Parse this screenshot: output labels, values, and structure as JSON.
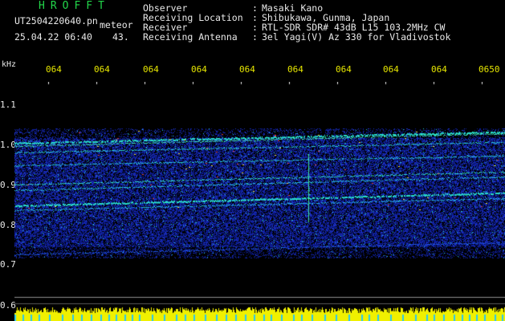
{
  "header": {
    "title": "HROFFT",
    "filename": "UT2504220640.pn",
    "meteor_label": "meteor",
    "datetime": "25.04.22 06:40",
    "count": "43."
  },
  "station": [
    {
      "label": "Observer",
      "value": "Masaki Kano"
    },
    {
      "label": "Receiving Location",
      "value": "Shibukawa, Gunma, Japan"
    },
    {
      "label": "Receiver",
      "value": "RTL-SDR SDR# 43dB L15 103.2MHz CW"
    },
    {
      "label": "Receiving Antenna",
      "value": "3el Yagi(V) Az 330 for Vladivostok"
    }
  ],
  "axis": {
    "unit": "kHz",
    "time_ticks": [
      "064",
      "064",
      "064",
      "064",
      "064",
      "064",
      "064",
      "064",
      "064",
      "0650"
    ],
    "freq_ticks": [
      "1.1",
      "1.0",
      "0.9",
      "0.8",
      "0.7",
      "0.6"
    ]
  },
  "colors": {
    "text_white": "#e8e8e8",
    "text_green": "#22d64a",
    "text_yellow": "#e6e600",
    "noise_blue": "#1e32c8",
    "echo_cyan": "#28dcc8",
    "power_yellow": "#f0f000"
  }
}
